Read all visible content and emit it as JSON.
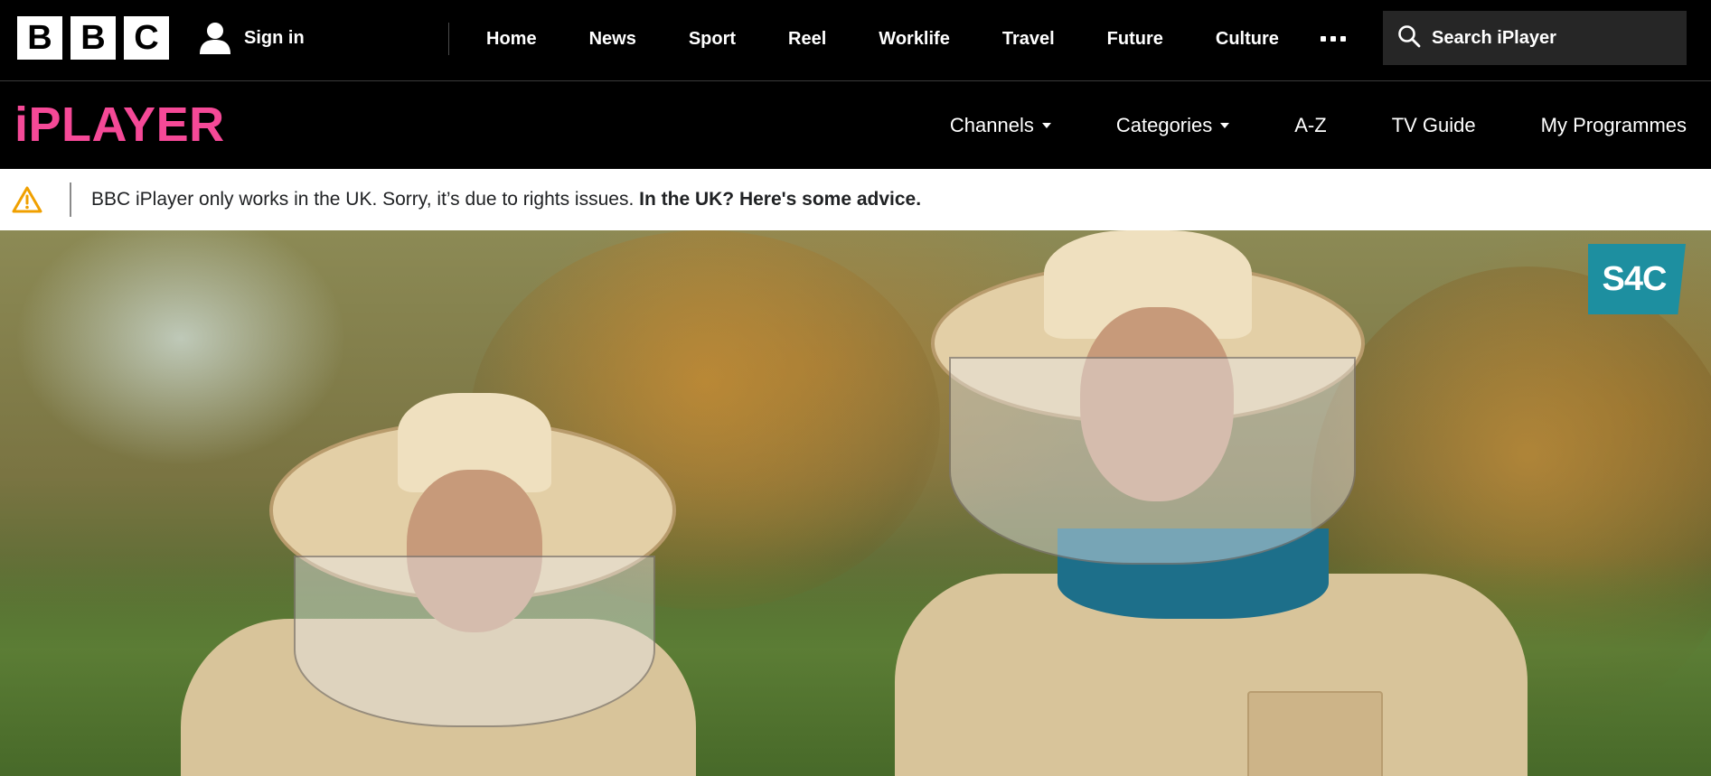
{
  "topbar": {
    "logo_letters": [
      "B",
      "B",
      "C"
    ],
    "sign_in_label": "Sign in",
    "nav": [
      {
        "label": "Home"
      },
      {
        "label": "News"
      },
      {
        "label": "Sport"
      },
      {
        "label": "Reel"
      },
      {
        "label": "Worklife"
      },
      {
        "label": "Travel"
      },
      {
        "label": "Future"
      },
      {
        "label": "Culture"
      }
    ],
    "more_icon": "more-dots-icon",
    "search": {
      "placeholder": "Search iPlayer",
      "icon": "search-icon"
    }
  },
  "iplayer": {
    "logo": "iPLAYER",
    "logo_color": "#f54997",
    "nav": [
      {
        "label": "Channels",
        "has_dropdown": true
      },
      {
        "label": "Categories",
        "has_dropdown": true
      },
      {
        "label": "A-Z"
      },
      {
        "label": "TV Guide"
      },
      {
        "label": "My Programmes"
      }
    ]
  },
  "banner": {
    "icon": "warning-icon",
    "message": "BBC iPlayer only works in the UK. Sorry, it’s due to rights issues.",
    "link": "In the UK? Here's some advice."
  },
  "hero": {
    "channel_badge": "S4C",
    "badge_color": "#1d8fa0"
  }
}
